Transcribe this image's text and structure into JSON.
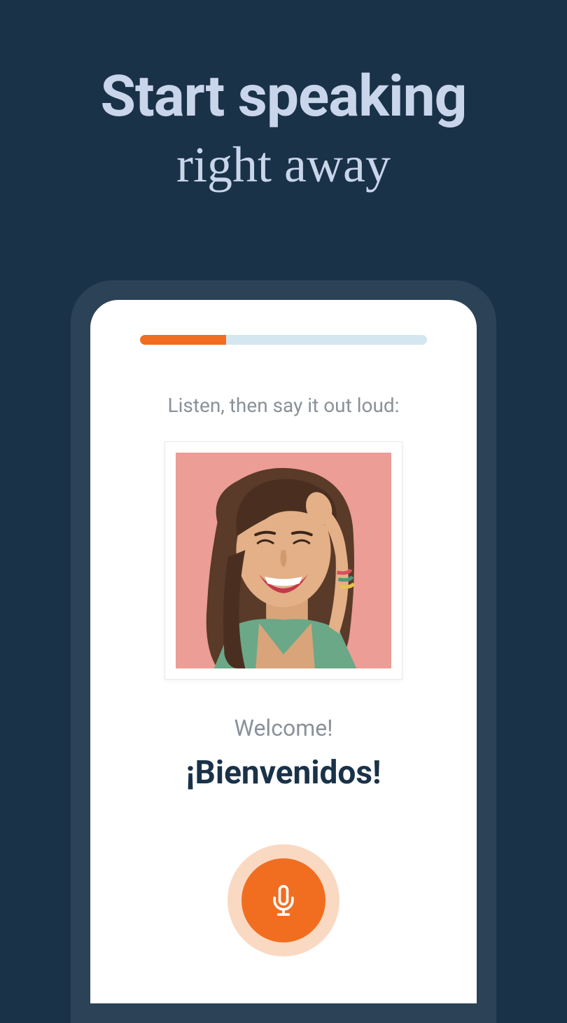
{
  "headline": {
    "line1": "Start speaking",
    "line2": "right away"
  },
  "lesson": {
    "instruction": "Listen, then say it out loud:",
    "translation": "Welcome!",
    "phrase": "¡Bienvenidos!",
    "progress_percent": 30
  },
  "colors": {
    "background": "#1a3248",
    "accent": "#f16e21",
    "progress_track": "#d4e7f0",
    "text_muted": "#8a9199",
    "headline": "#c9d5ea"
  }
}
